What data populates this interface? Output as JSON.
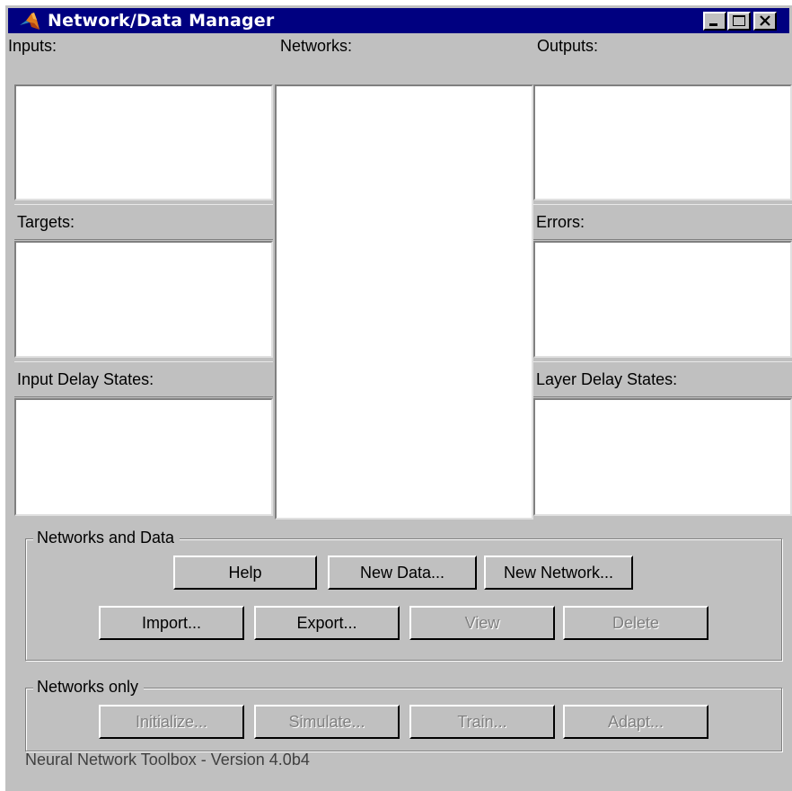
{
  "window": {
    "title": "Network/Data Manager",
    "controls": {
      "minimize": "minimize-icon",
      "maximize": "maximize-icon",
      "close": "close-icon"
    }
  },
  "panels": {
    "inputs": "Inputs:",
    "networks": "Networks:",
    "outputs": "Outputs:",
    "targets": "Targets:",
    "errors": "Errors:",
    "input_delay_states": "Input Delay States:",
    "layer_delay_states": "Layer Delay States:"
  },
  "networks_and_data": {
    "title": "Networks and Data",
    "buttons": {
      "help": "Help",
      "new_data": "New Data...",
      "new_network": "New Network...",
      "import": "Import...",
      "export": "Export...",
      "view": "View",
      "delete": "Delete"
    }
  },
  "networks_only": {
    "title": "Networks only",
    "buttons": {
      "initialize": "Initialize...",
      "simulate": "Simulate...",
      "train": "Train...",
      "adapt": "Adapt..."
    }
  },
  "status": "Neural Network Toolbox - Version 4.0b4",
  "colors": {
    "titlebar": "#000080",
    "face": "#c0c0c0",
    "list_bg": "#ffffff",
    "disabled_text": "#808080"
  }
}
